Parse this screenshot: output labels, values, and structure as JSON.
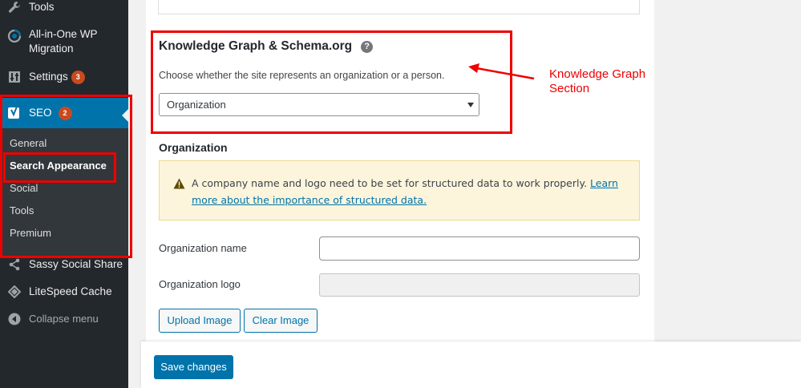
{
  "sidebar": {
    "items": [
      {
        "label": "Tools",
        "icon": "wrench-icon"
      },
      {
        "label": "All-in-One WP Migration",
        "icon": "migration-icon"
      },
      {
        "label": "Settings",
        "icon": "settings-icon",
        "badge": "3"
      },
      {
        "label": "SEO",
        "icon": "yoast-icon",
        "badge": "2"
      },
      {
        "label": "Sassy Social Share",
        "icon": "share-icon"
      },
      {
        "label": "LiteSpeed Cache",
        "icon": "diamond-icon"
      },
      {
        "label": "Collapse menu",
        "icon": "collapse-icon"
      }
    ],
    "all_in_one_line1": "All-in-One WP",
    "all_in_one_line2": "Migration",
    "submenu": [
      "General",
      "Search Appearance",
      "Social",
      "Tools",
      "Premium"
    ],
    "active_submenu": "Search Appearance"
  },
  "knowledge_graph": {
    "heading": "Knowledge Graph & Schema.org",
    "help_icon": "?",
    "description": "Choose whether the site represents an organization or a person.",
    "select_value": "Organization"
  },
  "organization": {
    "heading": "Organization",
    "notice_text": "A company name and logo need to be set for structured data to work properly.",
    "notice_link": "Learn more about the importance of structured data.",
    "name_label": "Organization name",
    "name_value": "",
    "logo_label": "Organization logo",
    "logo_value": "",
    "upload_button": "Upload Image",
    "clear_button": "Clear Image"
  },
  "save_button": "Save changes",
  "annotation": {
    "line1": "Knowledge Graph",
    "line2": "Section"
  },
  "colors": {
    "sidebar_bg": "#23282d",
    "accent": "#0073aa",
    "badge": "#ca4a1f",
    "annotation": "#ee0000",
    "notice_bg": "#fcf5dc"
  }
}
